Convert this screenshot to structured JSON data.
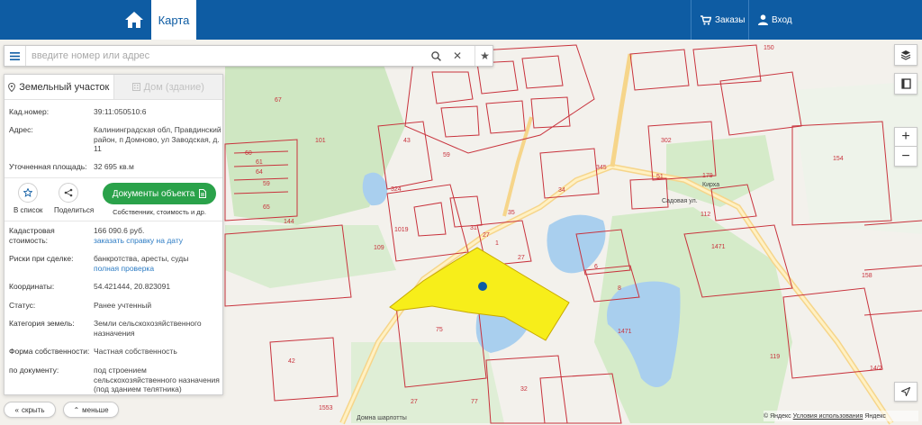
{
  "header": {
    "map_tab": "Карта",
    "orders": "Заказы",
    "login": "Вход"
  },
  "search": {
    "placeholder": "введите номер или адрес"
  },
  "panel": {
    "tab_land": "Земельный участок",
    "tab_house": "Дом (здание)",
    "cad_label": "Кад.номер:",
    "cad_value": "39:11:050510:6",
    "address_label": "Адрес:",
    "address_value": "Калининградская обл, Правдинский район, п Домново, ул Заводская, д. 11",
    "area_label": "Уточненная площадь:",
    "area_value": "32 695 кв.м",
    "in_list": "В список",
    "share": "Поделиться",
    "docs_button": "Документы объекта",
    "docs_sub": "Собственник, стоимость и др.",
    "cost_label": "Кадастровая стоимость:",
    "cost_value": "166 090.6 руб.",
    "cost_link": "заказать справку на дату",
    "risks_label": "Риски при сделке:",
    "risks_value": "банкротства, аресты, суды",
    "risks_link": "полная проверка",
    "coords_label": "Координаты:",
    "coords_value": "54.421444, 20.823091",
    "status_label": "Статус:",
    "status_value": "Ранее учтенный",
    "category_label": "Категория земель:",
    "category_value": "Земли сельскохозяйственного назначения",
    "ownership_label": "Форма собственности:",
    "ownership_value": "Частная собственность",
    "doc_label": "по документу:",
    "doc_value": "под строением сельскохозяйственного назначения (под зданием телятника)"
  },
  "bottom": {
    "hide": "скрыть",
    "less": "меньше"
  },
  "map": {
    "labels": [
      "101",
      "67",
      "60",
      "61",
      "64",
      "59",
      "65",
      "144",
      "150",
      "302",
      "154",
      "158",
      "1471",
      "1471",
      "75",
      "42",
      "32",
      "27",
      "77",
      "1553",
      "27",
      "119",
      "14/2",
      "109",
      "1019",
      "43",
      "59",
      "324",
      "51",
      "34",
      "345",
      "179",
      "112",
      "27",
      "1",
      "6",
      "8",
      "35",
      "31"
    ],
    "places": [
      "Домна шарлотты",
      "Кирха",
      "Садовая ул."
    ],
    "copyright": "© Яндекс",
    "terms": "Условия использования",
    "yandex": "Яндекс"
  },
  "colors": {
    "header": "#0e5ca3",
    "accent_green": "#2aa24a",
    "link": "#2d7cc4",
    "parcel_highlight": "#f7ee1a",
    "parcel_line": "#c8323c",
    "water": "#a9cfee",
    "forest": "#cfe7c2"
  }
}
